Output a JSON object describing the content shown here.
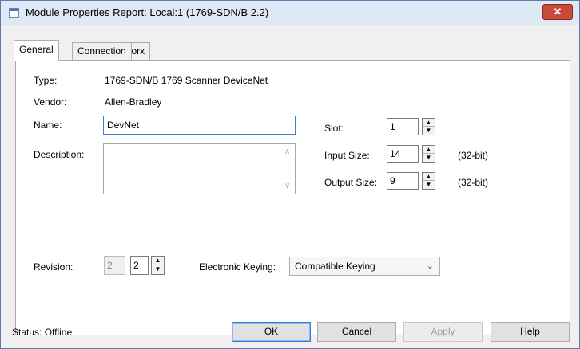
{
  "window": {
    "title": "Module Properties Report: Local:1 (1769-SDN/B 2.2)",
    "close_glyph": "✕"
  },
  "tabs": [
    {
      "label": "General",
      "active": true
    },
    {
      "label": "Connection",
      "active": false
    },
    {
      "label": "RSNetWorx",
      "active": false
    }
  ],
  "general": {
    "type_label": "Type:",
    "type_value": "1769-SDN/B 1769 Scanner DeviceNet",
    "vendor_label": "Vendor:",
    "vendor_value": "Allen-Bradley",
    "name_label": "Name:",
    "name_value": "DevNet",
    "description_label": "Description:",
    "description_value": "",
    "slot_label": "Slot:",
    "slot_value": "1",
    "input_size_label": "Input Size:",
    "input_size_value": "14",
    "input_size_unit": "(32-bit)",
    "output_size_label": "Output Size:",
    "output_size_value": "9",
    "output_size_unit": "(32-bit)",
    "revision_label": "Revision:",
    "revision_major": "2",
    "revision_minor": "2",
    "keying_label": "Electronic Keying:",
    "keying_value": "Compatible Keying"
  },
  "footer": {
    "status_text": "Status:  Offline",
    "ok_label": "OK",
    "cancel_label": "Cancel",
    "apply_label": "Apply",
    "help_label": "Help"
  },
  "icons": {
    "up": "▲",
    "down": "▼",
    "chevron": "⌄",
    "scroll_up": "∧",
    "scroll_down": "∨"
  }
}
